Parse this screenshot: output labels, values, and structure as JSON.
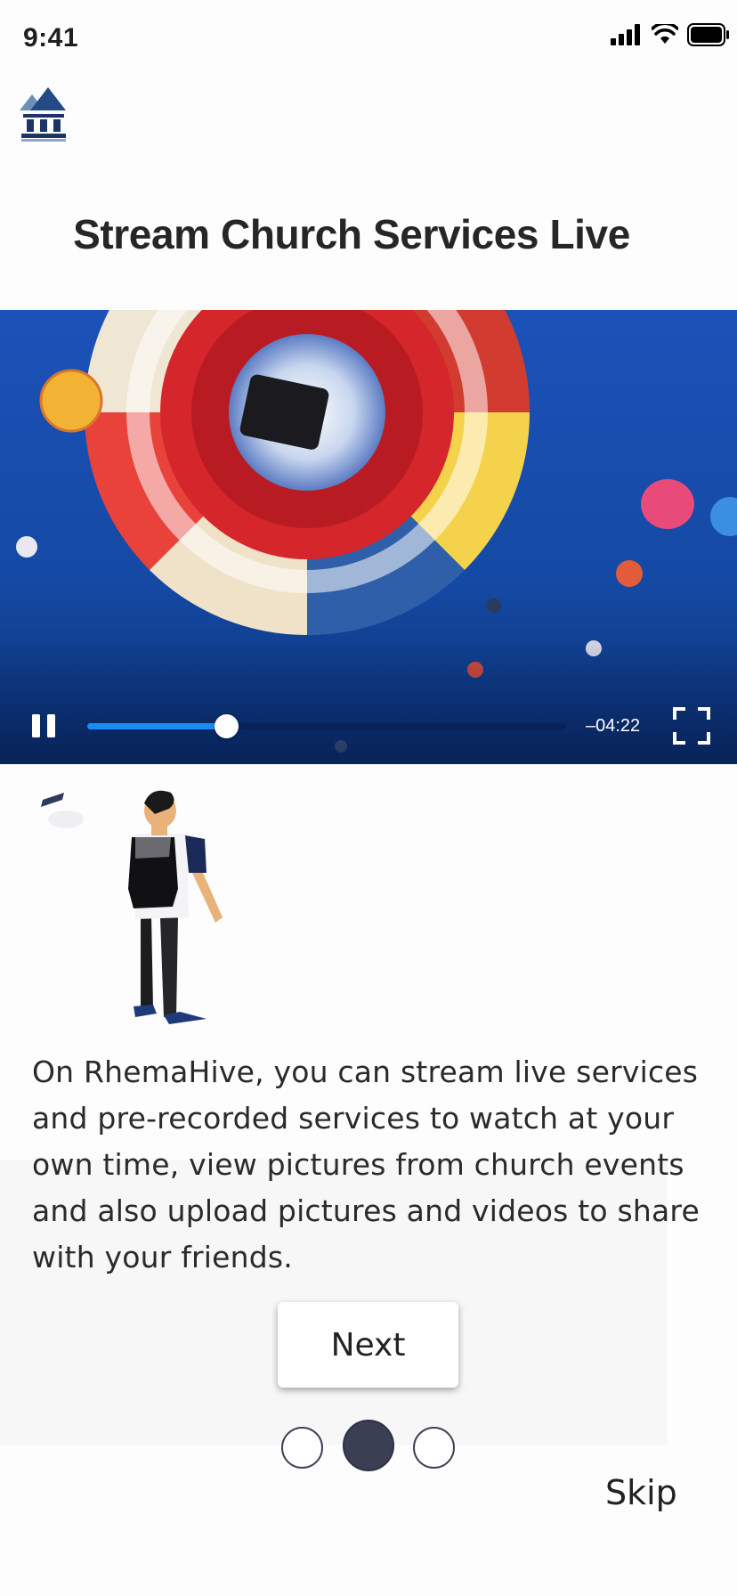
{
  "status_bar": {
    "time": "9:41"
  },
  "app": {
    "logo_icon": "church-icon"
  },
  "onboarding": {
    "title": "Stream Church Services Live",
    "description": "On RhemaHive, you can stream live services and pre-recorded services to watch at your own time, view pictures from church events and also upload pictures and videos to share with your friends.",
    "next_label": "Next",
    "skip_label": "Skip",
    "current_page": 2,
    "page_count": 3
  },
  "video_player": {
    "state": "playing",
    "time_remaining": "–04:22",
    "progress_fraction": 0.29
  },
  "colors": {
    "accent": "#1b8cf4",
    "dot_active": "#3a3f53",
    "sky": "#1548a8"
  }
}
